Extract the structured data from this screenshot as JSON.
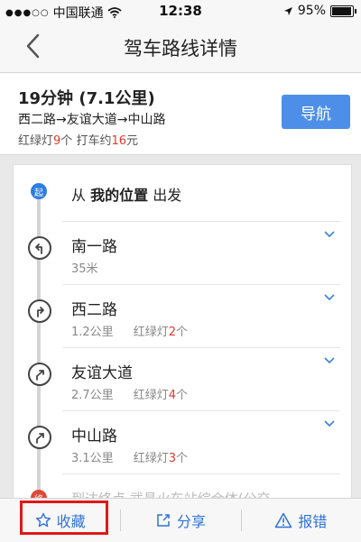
{
  "status_bar": {
    "carrier": "中国联通",
    "time": "12:38",
    "battery": "95%",
    "battery_level": 0.95
  },
  "nav": {
    "title": "驾车路线详情"
  },
  "summary": {
    "duration": "19分钟",
    "distance": "(7.1公里)",
    "route": "西二路→友谊大道→中山路",
    "lights_label": "红绿灯",
    "lights_count": "9",
    "lights_unit": "个",
    "taxi_label": "打车约",
    "taxi_cost": "16",
    "taxi_unit": "元",
    "navigate_button": "导航"
  },
  "start": {
    "badge": "起",
    "prefix": "从",
    "place": "我的位置",
    "suffix": "出发"
  },
  "steps": [
    {
      "name": "南一路",
      "distance": "35米",
      "turn": "left"
    },
    {
      "name": "西二路",
      "distance": "1.2公里",
      "lights_label": "红绿灯",
      "lights_count": "2",
      "lights_unit": "个",
      "turn": "right"
    },
    {
      "name": "友谊大道",
      "distance": "2.7公里",
      "lights_label": "红绿灯",
      "lights_count": "4",
      "lights_unit": "个",
      "turn": "slight-right"
    },
    {
      "name": "中山路",
      "distance": "3.1公里",
      "lights_label": "红绿灯",
      "lights_count": "3",
      "lights_unit": "个",
      "turn": "slight-right"
    }
  ],
  "end": {
    "badge": "终",
    "text": "到达终点 武昌火车站综合体(公交"
  },
  "bottom_bar": {
    "favorite": "收藏",
    "share": "分享",
    "report": "报错"
  },
  "colors": {
    "accent": "#4d8fe8",
    "link": "#2f72d6",
    "highlight": "#e03a2c",
    "annotation_box": "#e01818"
  },
  "icons": [
    "signal-dots-icon",
    "wifi-icon",
    "location-arrow-icon",
    "battery-icon",
    "back-chevron-icon",
    "turn-left-icon",
    "turn-right-icon",
    "slight-right-icon",
    "chevron-down-icon",
    "star-icon",
    "share-icon",
    "warning-icon"
  ]
}
